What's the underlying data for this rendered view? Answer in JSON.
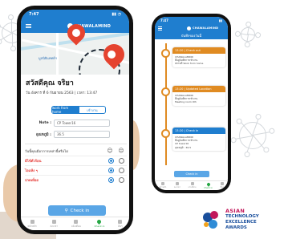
{
  "phone1": {
    "status": {
      "time": "7:47",
      "signal": "all"
    },
    "app_brand": "CHAWALAMIND",
    "map_labels": [
      "มูลนิธิแพทย์ฯ"
    ],
    "user_name": "สวัสดีคุณ จริยา",
    "date_line": "วัน อังคาร ที่ 6 กันยายน 2563 | เวลา: 13:47",
    "segments": {
      "active": "work from home",
      "inactive": "เข้างาน"
    },
    "fields": [
      {
        "label": "Note :",
        "value": "CP Tower16"
      },
      {
        "label": "อุณหภูมิ :",
        "value": "36.5"
      }
    ],
    "survey": {
      "question": "วันนี้คุณมีอาการเหล่านี้หรือไม่",
      "columns": [
        "ไม่ใช่",
        "ใช่"
      ],
      "rows": [
        {
          "label": "มีไข้ตัวร้อน",
          "answer": "no"
        },
        {
          "label": "ไอแห้ง ๆ",
          "answer": "no"
        },
        {
          "label": "ปวดเมื่อย",
          "answer": "no"
        }
      ]
    },
    "checkin_label": "Check in",
    "tabs": [
      "หน้าหลัก",
      "ลงเวลา",
      "แจ้งเตือน",
      "Check in",
      "อื่นๆ"
    ],
    "active_tab": 3
  },
  "phone2": {
    "status": {
      "time": "7:47"
    },
    "app_brand": "CHAWALAMIND",
    "title": "บันทึกของวันนี้",
    "entries": [
      {
        "header": "13:20 | Check out",
        "color": "orange",
        "lines": [
          "CHAWALAMIND",
          "ที่อยู่บันทึกการเข้างาน",
          "สถานที่ Work from home"
        ]
      },
      {
        "header": "13:20 | Updated Location",
        "color": "orange",
        "lines": [
          "CHAWALAMIND",
          "ที่อยู่บันทึกการเข้างาน",
          "Meeting room 4th"
        ]
      },
      {
        "header": "13:20 | Check in",
        "color": "blue",
        "lines": [
          "CHAWALAMIND",
          "ที่อยู่บันทึกการเข้างาน",
          "CP tower16",
          "อุณหภูมิ : 36.5"
        ]
      }
    ],
    "checkin_label": "Check in",
    "tabs": [
      "หน้าหลัก",
      "ลงเวลา",
      "แจ้งเตือน",
      "Check in",
      "อื่นๆ"
    ]
  },
  "award": {
    "line1": "ASIAN",
    "line2": "TECHNOLOGY",
    "line3": "EXCELLENCE",
    "line4": "AWARDS"
  },
  "colors": {
    "primary": "#1f7ecf",
    "accent": "#e08b22",
    "pin": "#e5432f",
    "alert_text": "#e53935"
  }
}
